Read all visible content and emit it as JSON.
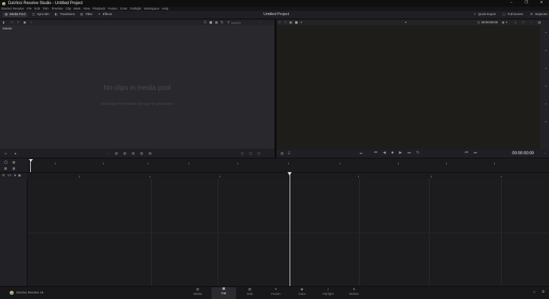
{
  "window": {
    "title": "DaVinci Resolve Studio - Untitled Project",
    "controls": [
      "minimize-icon",
      "maximize-icon",
      "close-icon"
    ]
  },
  "menubar": {
    "items": [
      "DaVinci Resolve",
      "File",
      "Edit",
      "Trim",
      "Timeline",
      "Clip",
      "Mark",
      "View",
      "Playback",
      "Fusion",
      "Color",
      "Fairlight",
      "Workspace",
      "Help"
    ]
  },
  "toolbar": {
    "left": [
      {
        "icon": "media-pool-icon",
        "label": "Media Pool"
      },
      {
        "icon": "sync-bin-icon",
        "label": "Sync Bin"
      },
      {
        "icon": "transitions-icon",
        "label": "Transitions"
      },
      {
        "icon": "titles-icon",
        "label": "Titles"
      },
      {
        "icon": "effects-icon",
        "label": "Effects"
      }
    ],
    "project_title": "Untitled Project",
    "right": [
      {
        "icon": "quick-export-icon",
        "label": "Quick Export"
      },
      {
        "icon": "full-screen-icon",
        "label": "Full Screen"
      },
      {
        "icon": "inspector-icon",
        "label": "Inspector"
      }
    ]
  },
  "media_pool": {
    "bin_label": "Master",
    "search_placeholder": "Search",
    "empty_title": "No clips in media pool",
    "empty_subtitle": "Add clips from Media Storage to get started"
  },
  "viewer": {
    "timecode_top": "00:00:00:00",
    "timecode": "00:00:00:00"
  },
  "timeline": {
    "track_label": "V1"
  },
  "footer": {
    "app_name": "DaVinci Resolve 18",
    "pages": [
      {
        "icon": "media-page-icon",
        "label": "Media",
        "active": false
      },
      {
        "icon": "cut-page-icon",
        "label": "Cut",
        "active": true
      },
      {
        "icon": "edit-page-icon",
        "label": "Edit",
        "active": false
      },
      {
        "icon": "fusion-page-icon",
        "label": "Fusion",
        "active": false
      },
      {
        "icon": "color-page-icon",
        "label": "Color",
        "active": false
      },
      {
        "icon": "fairlight-page-icon",
        "label": "Fairlight",
        "active": false
      },
      {
        "icon": "deliver-page-icon",
        "label": "Deliver",
        "active": false
      }
    ]
  },
  "colors": {
    "accent": "#ff6a3d",
    "active_page": "#ffffff",
    "panel_bg": "#28282d",
    "viewer_bg": "#1e1d1a"
  }
}
